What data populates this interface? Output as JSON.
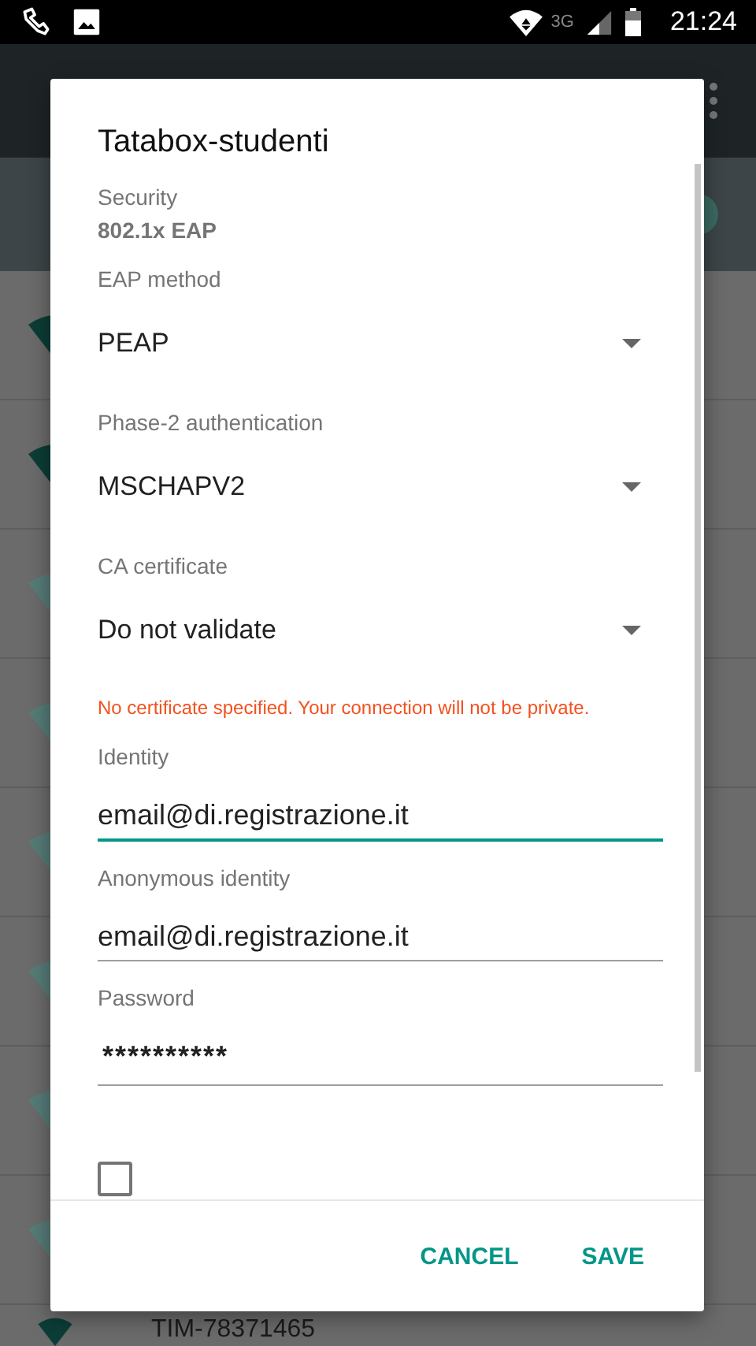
{
  "status_bar": {
    "network": "3G",
    "time": "21:24"
  },
  "switch_bar": {
    "on": true
  },
  "background_network": {
    "name": "TIM-78371465"
  },
  "dialog": {
    "title": "Tatabox-studenti",
    "security": {
      "label": "Security",
      "value": "802.1x EAP"
    },
    "fields": [
      {
        "kind": "dropdown",
        "label": "EAP method",
        "value": "PEAP"
      },
      {
        "kind": "dropdown",
        "label": "Phase-2 authentication",
        "value": "MSCHAPV2"
      },
      {
        "kind": "dropdown",
        "label": "CA certificate",
        "value": "Do not validate"
      },
      {
        "kind": "warning",
        "text": "No certificate specified. Your connection will not be private."
      },
      {
        "kind": "text",
        "label": "Identity",
        "value": "email@di.registrazione.it",
        "focused": true
      },
      {
        "kind": "text",
        "label": "Anonymous identity",
        "value": "email@di.registrazione.it",
        "focused": false
      },
      {
        "kind": "password",
        "label": "Password",
        "value": "**********",
        "focused": false
      },
      {
        "kind": "checkbox",
        "checked": false
      }
    ],
    "buttons": [
      "CANCEL",
      "SAVE"
    ]
  }
}
